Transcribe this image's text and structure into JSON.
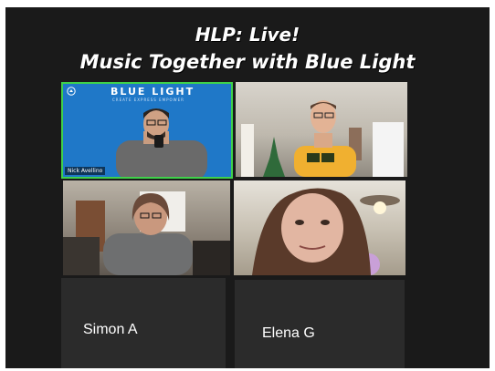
{
  "header": {
    "title_line1": "HLP: Live!",
    "title_line2": "Music Together with Blue Light"
  },
  "tiles": {
    "nick": {
      "brand": "BLUE LIGHT",
      "brand_tagline": "CREATE  EXPRESS  EMPOWER",
      "name_tag": "Nick Avellino",
      "speaker_highlight_color": "#3fd14a",
      "background_color": "#1f78c8"
    },
    "simon": {
      "label": "Simon A"
    },
    "elena": {
      "label": "Elena G"
    }
  },
  "icons": [
    "blue-light-logo-icon"
  ]
}
